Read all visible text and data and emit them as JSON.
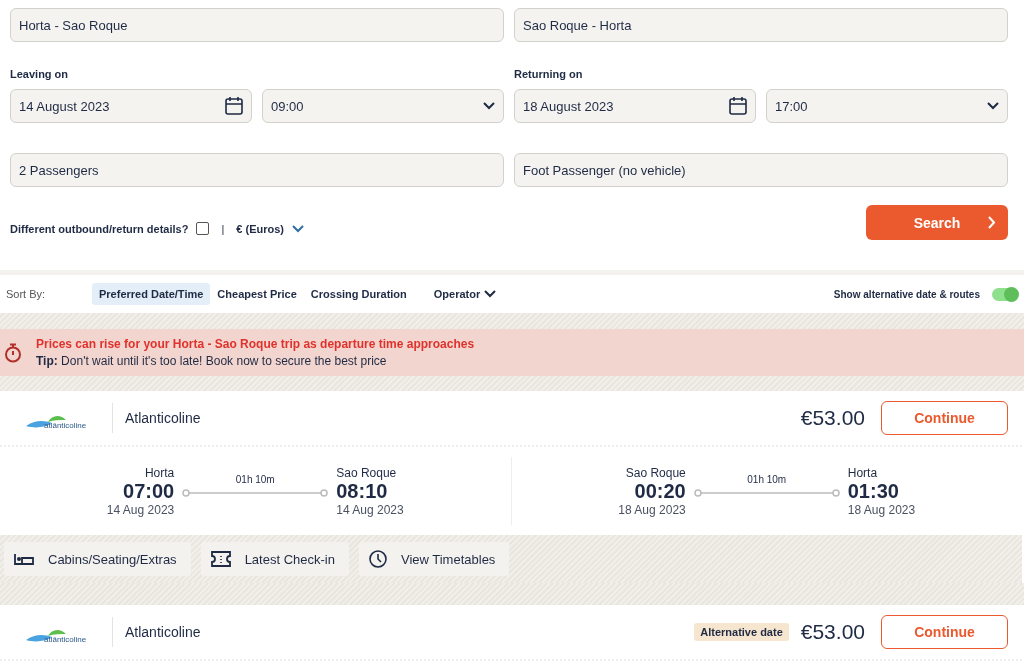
{
  "route_fields": [
    {
      "value": "Horta - Sao Roque"
    },
    {
      "value": "Sao Roque - Horta"
    }
  ],
  "date_groups": [
    {
      "label": "Leaving on",
      "date": "14 August 2023",
      "time": "09:00"
    },
    {
      "label": "Returning on",
      "date": "18 August 2023",
      "time": "17:00"
    }
  ],
  "passengers": {
    "value": "2 Passengers"
  },
  "vehicle": {
    "value": "Foot Passenger (no vehicle)"
  },
  "options": {
    "different_details_label": "Different outbound/return details?",
    "different_details_checked": false,
    "separator": "|",
    "currency": "€ (Euros)"
  },
  "search_button": "Search",
  "sort": {
    "label": "Sort By:",
    "options": [
      {
        "label": "Preferred Date/Time",
        "selected": true
      },
      {
        "label": "Cheapest Price",
        "selected": false
      },
      {
        "label": "Crossing Duration",
        "selected": false
      }
    ],
    "operator": "Operator",
    "alt_label": "Show alternative date & routes",
    "alt_on": true
  },
  "alert": {
    "title": "Prices can rise for your Horta - Sao Roque trip as departure time approaches",
    "tip": "**Tip:** Don't wait until it's too late! Book now to secure the best price"
  },
  "results": [
    {
      "logo_text": "atlânticoline",
      "operator": "Atlanticoline",
      "price": "€53.00",
      "button": "Continue",
      "legs": [
        {
          "from": "Horta",
          "dep": "07:00",
          "dep_date": "14 Aug 2023",
          "duration": "01h 10m",
          "to": "Sao Roque",
          "arr": "08:10",
          "arr_date": "14 Aug 2023"
        },
        {
          "from": "Sao Roque",
          "dep": "00:20",
          "dep_date": "18 Aug 2023",
          "duration": "01h 10m",
          "to": "Horta",
          "arr": "01:30",
          "arr_date": "18 Aug 2023"
        }
      ],
      "extras": [
        {
          "kind": "bed",
          "label": "Cabins/Seating/Extras"
        },
        {
          "kind": "ticket",
          "label": "Latest Check-in"
        },
        {
          "kind": "clock",
          "label": "View Timetables"
        }
      ]
    },
    {
      "logo_text": "atlânticoline",
      "operator": "Atlanticoline",
      "badge": "Alternative date",
      "price": "€53.00",
      "button": "Continue"
    }
  ]
}
